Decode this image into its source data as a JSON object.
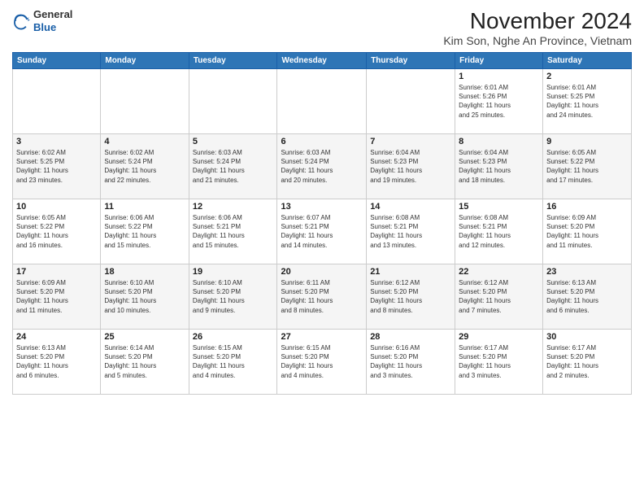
{
  "logo": {
    "general": "General",
    "blue": "Blue"
  },
  "header": {
    "title": "November 2024",
    "subtitle": "Kim Son, Nghe An Province, Vietnam"
  },
  "calendar": {
    "days_of_week": [
      "Sunday",
      "Monday",
      "Tuesday",
      "Wednesday",
      "Thursday",
      "Friday",
      "Saturday"
    ],
    "weeks": [
      [
        {
          "day": "",
          "info": ""
        },
        {
          "day": "",
          "info": ""
        },
        {
          "day": "",
          "info": ""
        },
        {
          "day": "",
          "info": ""
        },
        {
          "day": "",
          "info": ""
        },
        {
          "day": "1",
          "info": "Sunrise: 6:01 AM\nSunset: 5:26 PM\nDaylight: 11 hours\nand 25 minutes."
        },
        {
          "day": "2",
          "info": "Sunrise: 6:01 AM\nSunset: 5:25 PM\nDaylight: 11 hours\nand 24 minutes."
        }
      ],
      [
        {
          "day": "3",
          "info": "Sunrise: 6:02 AM\nSunset: 5:25 PM\nDaylight: 11 hours\nand 23 minutes."
        },
        {
          "day": "4",
          "info": "Sunrise: 6:02 AM\nSunset: 5:24 PM\nDaylight: 11 hours\nand 22 minutes."
        },
        {
          "day": "5",
          "info": "Sunrise: 6:03 AM\nSunset: 5:24 PM\nDaylight: 11 hours\nand 21 minutes."
        },
        {
          "day": "6",
          "info": "Sunrise: 6:03 AM\nSunset: 5:24 PM\nDaylight: 11 hours\nand 20 minutes."
        },
        {
          "day": "7",
          "info": "Sunrise: 6:04 AM\nSunset: 5:23 PM\nDaylight: 11 hours\nand 19 minutes."
        },
        {
          "day": "8",
          "info": "Sunrise: 6:04 AM\nSunset: 5:23 PM\nDaylight: 11 hours\nand 18 minutes."
        },
        {
          "day": "9",
          "info": "Sunrise: 6:05 AM\nSunset: 5:22 PM\nDaylight: 11 hours\nand 17 minutes."
        }
      ],
      [
        {
          "day": "10",
          "info": "Sunrise: 6:05 AM\nSunset: 5:22 PM\nDaylight: 11 hours\nand 16 minutes."
        },
        {
          "day": "11",
          "info": "Sunrise: 6:06 AM\nSunset: 5:22 PM\nDaylight: 11 hours\nand 15 minutes."
        },
        {
          "day": "12",
          "info": "Sunrise: 6:06 AM\nSunset: 5:21 PM\nDaylight: 11 hours\nand 15 minutes."
        },
        {
          "day": "13",
          "info": "Sunrise: 6:07 AM\nSunset: 5:21 PM\nDaylight: 11 hours\nand 14 minutes."
        },
        {
          "day": "14",
          "info": "Sunrise: 6:08 AM\nSunset: 5:21 PM\nDaylight: 11 hours\nand 13 minutes."
        },
        {
          "day": "15",
          "info": "Sunrise: 6:08 AM\nSunset: 5:21 PM\nDaylight: 11 hours\nand 12 minutes."
        },
        {
          "day": "16",
          "info": "Sunrise: 6:09 AM\nSunset: 5:20 PM\nDaylight: 11 hours\nand 11 minutes."
        }
      ],
      [
        {
          "day": "17",
          "info": "Sunrise: 6:09 AM\nSunset: 5:20 PM\nDaylight: 11 hours\nand 11 minutes."
        },
        {
          "day": "18",
          "info": "Sunrise: 6:10 AM\nSunset: 5:20 PM\nDaylight: 11 hours\nand 10 minutes."
        },
        {
          "day": "19",
          "info": "Sunrise: 6:10 AM\nSunset: 5:20 PM\nDaylight: 11 hours\nand 9 minutes."
        },
        {
          "day": "20",
          "info": "Sunrise: 6:11 AM\nSunset: 5:20 PM\nDaylight: 11 hours\nand 8 minutes."
        },
        {
          "day": "21",
          "info": "Sunrise: 6:12 AM\nSunset: 5:20 PM\nDaylight: 11 hours\nand 8 minutes."
        },
        {
          "day": "22",
          "info": "Sunrise: 6:12 AM\nSunset: 5:20 PM\nDaylight: 11 hours\nand 7 minutes."
        },
        {
          "day": "23",
          "info": "Sunrise: 6:13 AM\nSunset: 5:20 PM\nDaylight: 11 hours\nand 6 minutes."
        }
      ],
      [
        {
          "day": "24",
          "info": "Sunrise: 6:13 AM\nSunset: 5:20 PM\nDaylight: 11 hours\nand 6 minutes."
        },
        {
          "day": "25",
          "info": "Sunrise: 6:14 AM\nSunset: 5:20 PM\nDaylight: 11 hours\nand 5 minutes."
        },
        {
          "day": "26",
          "info": "Sunrise: 6:15 AM\nSunset: 5:20 PM\nDaylight: 11 hours\nand 4 minutes."
        },
        {
          "day": "27",
          "info": "Sunrise: 6:15 AM\nSunset: 5:20 PM\nDaylight: 11 hours\nand 4 minutes."
        },
        {
          "day": "28",
          "info": "Sunrise: 6:16 AM\nSunset: 5:20 PM\nDaylight: 11 hours\nand 3 minutes."
        },
        {
          "day": "29",
          "info": "Sunrise: 6:17 AM\nSunset: 5:20 PM\nDaylight: 11 hours\nand 3 minutes."
        },
        {
          "day": "30",
          "info": "Sunrise: 6:17 AM\nSunset: 5:20 PM\nDaylight: 11 hours\nand 2 minutes."
        }
      ]
    ]
  }
}
